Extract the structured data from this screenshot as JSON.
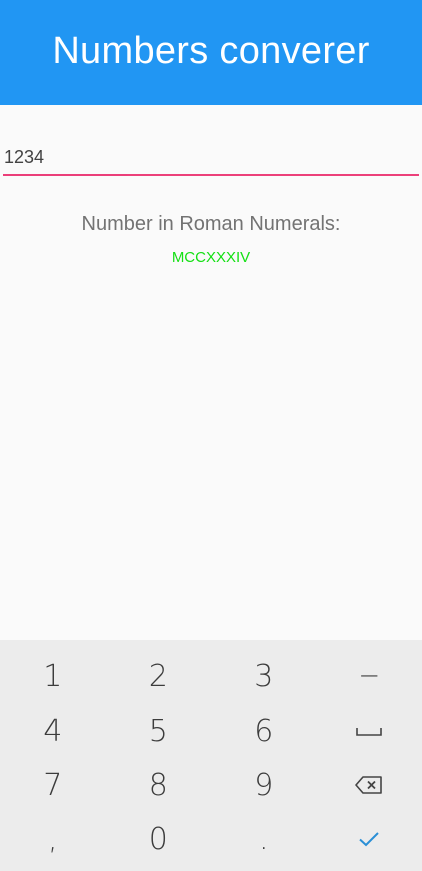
{
  "app_bar": {
    "title": "Numbers converer",
    "color": "#2196f3"
  },
  "input": {
    "value": "1234",
    "underline_color": "#e91e63"
  },
  "result": {
    "label": "Number in Roman Numerals:",
    "value": "MCCXXXIV",
    "value_color": "#14e014"
  },
  "keyboard": {
    "rows": [
      [
        "1",
        "2",
        "3",
        "−"
      ],
      [
        "4",
        "5",
        "6",
        "space-icon"
      ],
      [
        "7",
        "8",
        "9",
        "backspace-icon"
      ],
      [
        ",",
        "0",
        ".",
        "checkmark-icon"
      ]
    ],
    "check_color": "#2a8fd6"
  }
}
